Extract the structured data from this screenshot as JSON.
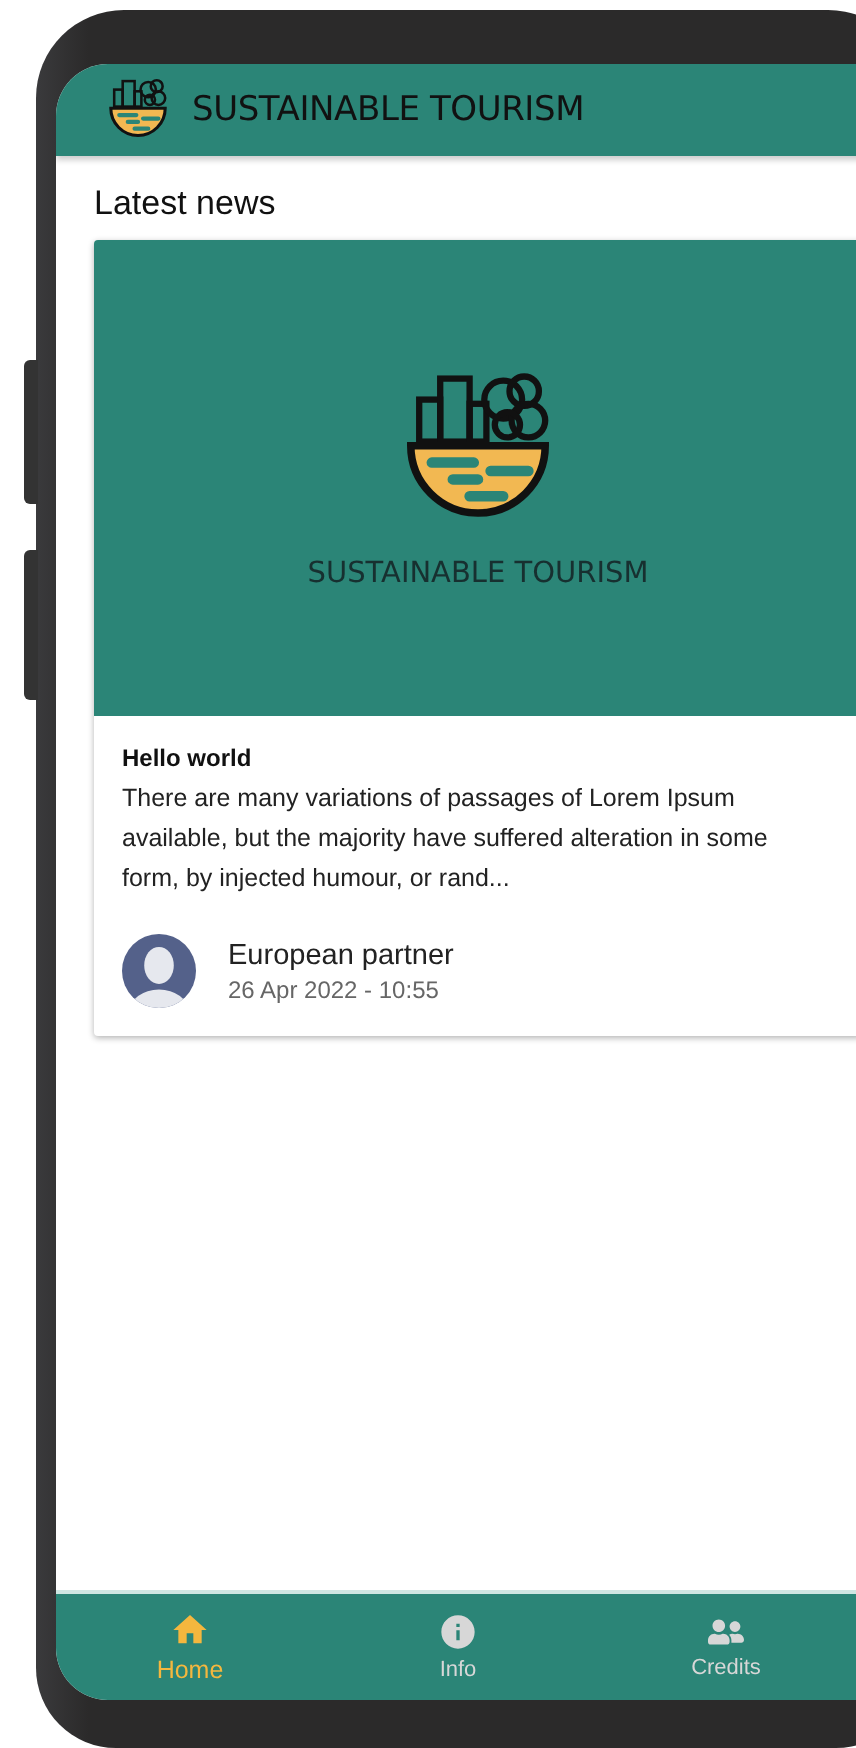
{
  "app_bar": {
    "title": "SUSTAINABLE TOURISM"
  },
  "section_title": "Latest news",
  "news": [
    {
      "banner_title": "SUSTAINABLE TOURISM",
      "title": "Hello world",
      "excerpt": "There are many variations of passages of Lorem Ipsum available, but the majority have suffered alteration in some form, by injected humour, or rand...",
      "author": "European partner",
      "date": "26 Apr 2022 - 10:55"
    }
  ],
  "bottom_nav": [
    {
      "label": "Home",
      "kind": "home",
      "selected": true
    },
    {
      "label": "Info",
      "kind": "info",
      "selected": false
    },
    {
      "label": "Credits",
      "kind": "credits",
      "selected": false
    }
  ]
}
